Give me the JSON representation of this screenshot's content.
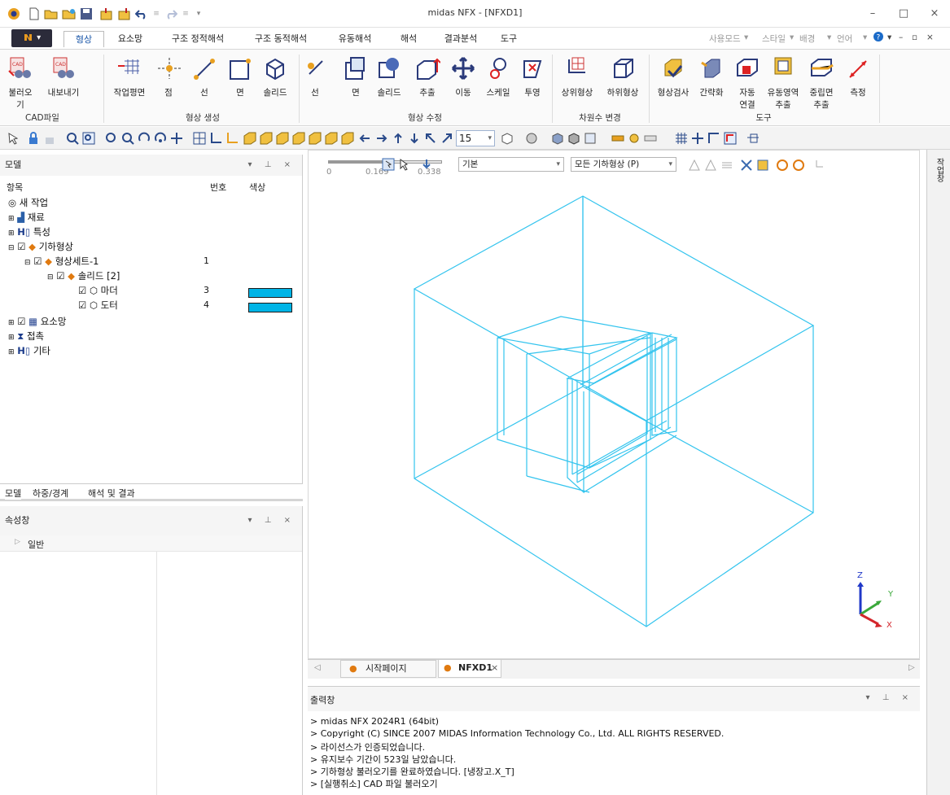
{
  "window": {
    "title": "midas NFX - [NFXD1]",
    "controls": {
      "minimize": "–",
      "maximize": "□",
      "close": "×"
    }
  },
  "menu": {
    "tabs": [
      "형상",
      "요소망",
      "구조 정적해석",
      "구조 동적해석",
      "유동해석",
      "해석",
      "결과분석",
      "도구"
    ],
    "active_tab": "형상",
    "right": [
      "사용모드",
      "스타일",
      "배경",
      "언어"
    ]
  },
  "ribbon": {
    "cad": {
      "import": "불러오기",
      "export": "내보내기",
      "group": "CAD파일"
    },
    "create": {
      "plane": "작업평면",
      "point": "점",
      "line": "선",
      "face": "면",
      "solid": "솔리드",
      "group": "형상 생성"
    },
    "modify": {
      "line": "선",
      "face": "면",
      "solid": "솔리드",
      "extrude": "추출",
      "move": "이동",
      "scale": "스케일",
      "project": "투영",
      "group": "형상 수정"
    },
    "dim": {
      "upper": "상위형상",
      "lower": "하위형상",
      "group": "차원수 변경"
    },
    "tools": {
      "check": "형상검사",
      "simplify": "간략화",
      "auto_connect_1": "자동",
      "auto_connect_2": "연결",
      "fluid_1": "유동영역",
      "fluid_2": "추출",
      "mid_1": "중립면",
      "mid_2": "추출",
      "measure": "측정",
      "group": "도구"
    }
  },
  "toolbar2": {
    "step_value": "15"
  },
  "model_panel": {
    "title": "모델",
    "columns": {
      "item": "항목",
      "num": "번호",
      "color": "색상"
    },
    "tree": {
      "root": "새 작업",
      "material": "재료",
      "property": "특성",
      "geometry": "기하형상",
      "shape_set": "형상세트-1",
      "shape_set_num": "1",
      "solid": "솔리드 [2]",
      "madeo": "마더",
      "madeo_num": "3",
      "doter": "도터",
      "doter_num": "4",
      "mesh": "요소망",
      "contact": "접촉",
      "other": "기타"
    },
    "tabs": [
      "모델",
      "하중/경계",
      "해석 및 결과"
    ]
  },
  "prop_panel": {
    "title": "속성창",
    "section": "일반"
  },
  "viewport": {
    "scale_labels": [
      "0",
      "0.169",
      "0.338"
    ],
    "filter_dropdown": "기본",
    "geometry_dropdown": "모든 기하형상 (P)",
    "axis": {
      "z": "Z",
      "y": "Y",
      "x": "X"
    },
    "colors": {
      "wire": "#33c4ee",
      "axis_x": "#d4262c",
      "axis_y": "#3aa83a",
      "axis_z": "#2038c8"
    }
  },
  "view_tabs": {
    "start": "시작페이지",
    "doc": "NFXD1"
  },
  "output": {
    "title": "출력창",
    "lines": [
      "> midas NFX 2024R1 (64bit)",
      "> Copyright (C) SINCE 2007 MIDAS Information Technology Co., Ltd. ALL RIGHTS RESERVED.",
      "> 라이선스가 인증되었습니다.",
      "> 유지보수 기간이 523일 남았습니다.",
      "> 기하형상 불러오기를 완료하였습니다. [냉장고.X_T]",
      "> [실행취소] CAD 파일 불러오기"
    ]
  },
  "right_strip": {
    "label": "작업창"
  }
}
